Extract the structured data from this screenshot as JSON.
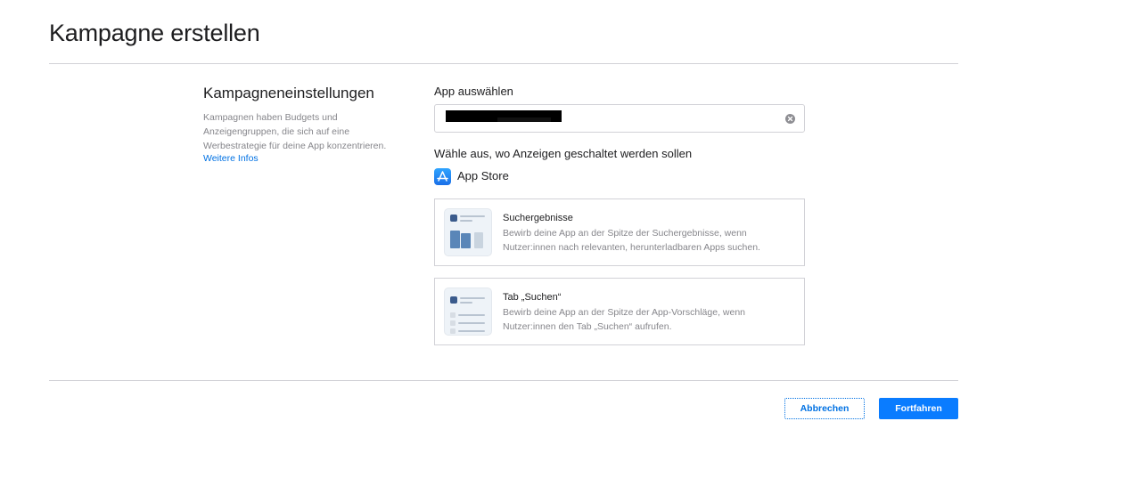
{
  "header": {
    "title": "Kampagne erstellen"
  },
  "settings": {
    "title": "Kampagneneinstellungen",
    "description": "Kampagnen haben Budgets und Anzeigengruppen, die sich auf eine Werbestrategie für deine App konzentrieren.",
    "more_link": "Weitere Infos"
  },
  "app_select": {
    "label": "App auswählen",
    "value_redacted": true,
    "clear_icon": "clear-circle-icon"
  },
  "placement": {
    "label": "Wähle aus, wo Anzeigen geschaltet werden sollen",
    "store": {
      "icon": "app-store-icon",
      "label": "App Store"
    },
    "options": [
      {
        "title": "Suchergebnisse",
        "description": "Bewirb deine App an der Spitze der Suchergebnisse, wenn Nutzer:innen nach relevanten, herunterladbaren Apps suchen."
      },
      {
        "title": "Tab „Suchen“",
        "description": "Bewirb deine App an der Spitze der App-Vorschläge, wenn Nutzer:innen den Tab „Suchen“ aufrufen."
      }
    ]
  },
  "footer": {
    "cancel_label": "Abbrechen",
    "continue_label": "Fortfahren"
  },
  "colors": {
    "accent": "#0071e3",
    "primary_button": "#0a7cff",
    "divider": "#d2d2d7",
    "muted_text": "#86868b"
  }
}
